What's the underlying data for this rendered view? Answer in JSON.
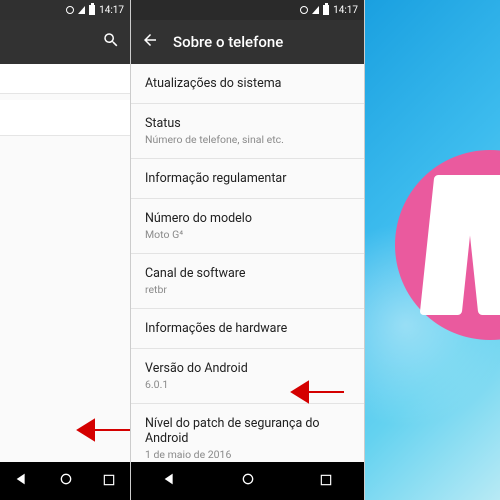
{
  "statusbar": {
    "time": "14:17"
  },
  "panel1": {
    "toolbar": {}
  },
  "panel2": {
    "toolbar": {
      "title": "Sobre o telefone"
    },
    "items": [
      {
        "primary": "Atualizações do sistema",
        "secondary": ""
      },
      {
        "primary": "Status",
        "secondary": "Número de telefone, sinal etc."
      },
      {
        "primary": "Informação regulamentar",
        "secondary": ""
      },
      {
        "primary": "Número do modelo",
        "secondary": "Moto G⁴"
      },
      {
        "primary": "Canal de software",
        "secondary": "retbr"
      },
      {
        "primary": "Informações de hardware",
        "secondary": ""
      },
      {
        "primary": "Versão do Android",
        "secondary": "6.0.1"
      },
      {
        "primary": "Nível do patch de segurança do Android",
        "secondary": "1 de maio de 2016"
      }
    ]
  },
  "annotations": {
    "arrow_color": "#d40000"
  },
  "easteregg": {
    "letter": "M",
    "circle_color": "#ea5a9e"
  }
}
